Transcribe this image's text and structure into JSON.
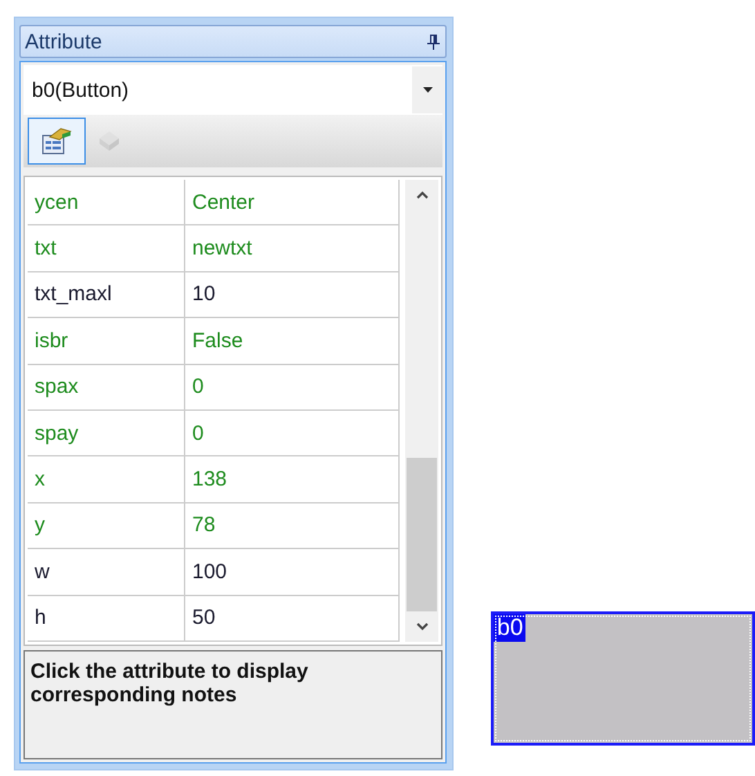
{
  "panel": {
    "title": "Attribute"
  },
  "object_select": {
    "value": "b0(Button)"
  },
  "toolbar": [
    {
      "kind": "properties",
      "selected": true,
      "disabled": false
    },
    {
      "kind": "events",
      "selected": false,
      "disabled": true
    }
  ],
  "attributes": [
    {
      "name": "ycen",
      "value": "Center",
      "color": "#1e8c1e"
    },
    {
      "name": "txt",
      "value": "newtxt",
      "color": "#1e8c1e"
    },
    {
      "name": "txt_maxl",
      "value": "10",
      "color": "#1a1a2e"
    },
    {
      "name": "isbr",
      "value": "False",
      "color": "#1e8c1e"
    },
    {
      "name": "spax",
      "value": "0",
      "color": "#1e8c1e"
    },
    {
      "name": "spay",
      "value": "0",
      "color": "#1e8c1e"
    },
    {
      "name": "x",
      "value": "138",
      "color": "#1e8c1e"
    },
    {
      "name": "y",
      "value": "78",
      "color": "#1e8c1e"
    },
    {
      "name": "w",
      "value": "100",
      "color": "#1a1a2e"
    },
    {
      "name": "h",
      "value": "50",
      "color": "#1a1a2e"
    }
  ],
  "notes": "Click the attribute to display corresponding notes",
  "canvas_button": {
    "label": "b0",
    "selected": true
  }
}
